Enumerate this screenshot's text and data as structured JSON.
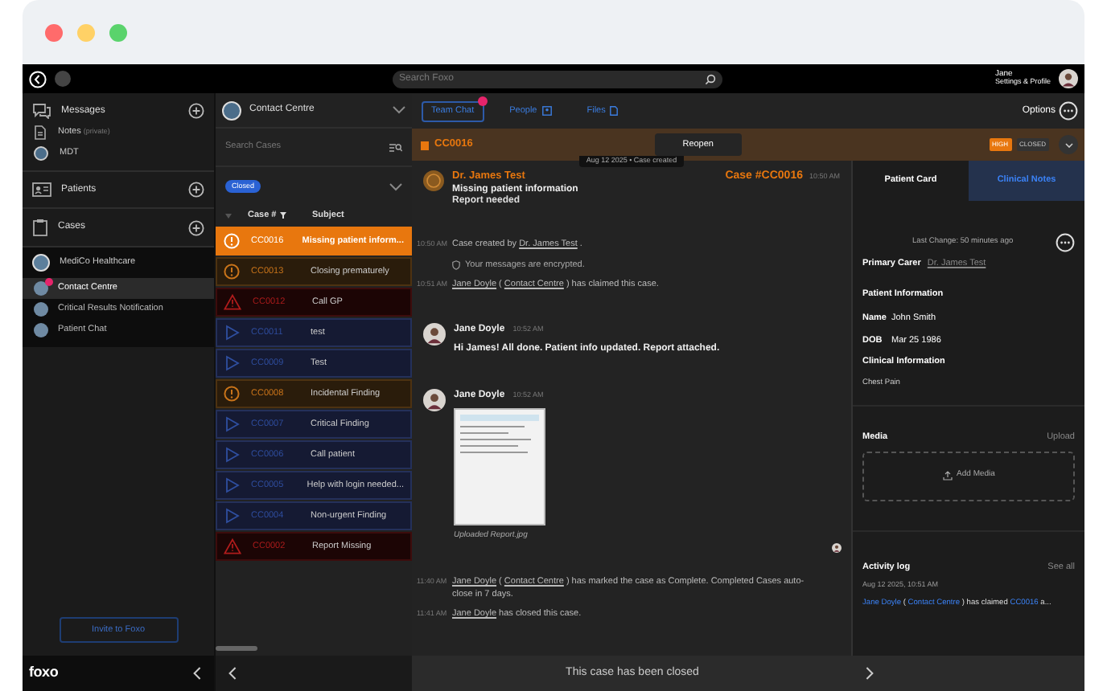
{
  "top_bar": {
    "search_placeholder": "Search Foxo",
    "user_name": "Jane",
    "user_subtitle": "Settings & Profile"
  },
  "sidebar": {
    "sections": [
      {
        "label": "Messages",
        "kind": "messages",
        "items": [
          {
            "label": "Notes",
            "note": "(private)",
            "kind": "note"
          },
          {
            "label": "MDT",
            "kind": "group"
          }
        ]
      },
      {
        "label": "Patients",
        "kind": "patients"
      },
      {
        "label": "Cases",
        "kind": "cases"
      }
    ],
    "organisation": {
      "name": "MediCo Healthcare",
      "channels": [
        {
          "label": "Contact Centre",
          "selected": true,
          "unread": true
        },
        {
          "label": "Critical Results Notification",
          "selected": false,
          "unread": false
        },
        {
          "label": "Patient Chat",
          "selected": false,
          "unread": false
        }
      ]
    },
    "invite_button": "Invite to Foxo",
    "logo": "foxo"
  },
  "cases_panel": {
    "title": "Contact Centre",
    "search_placeholder": "Search Cases",
    "filter_chip": "Closed",
    "columns": [
      "Case #",
      "Subject"
    ],
    "rows": [
      {
        "id": "CC0016",
        "subject": "Missing patient inform...",
        "kind": "warning",
        "selected": true
      },
      {
        "id": "CC0013",
        "subject": "Closing prematurely",
        "kind": "warning",
        "selected": false
      },
      {
        "id": "CC0012",
        "subject": "Call GP",
        "kind": "critical",
        "selected": false
      },
      {
        "id": "CC0011",
        "subject": "test",
        "kind": "info",
        "selected": false
      },
      {
        "id": "CC0009",
        "subject": "Test",
        "kind": "info",
        "selected": false
      },
      {
        "id": "CC0008",
        "subject": "Incidental Finding",
        "kind": "warning",
        "selected": false
      },
      {
        "id": "CC0007",
        "subject": "Critical Finding",
        "kind": "info",
        "selected": false
      },
      {
        "id": "CC0006",
        "subject": "Call patient",
        "kind": "info",
        "selected": false
      },
      {
        "id": "CC0005",
        "subject": "Help with login needed...",
        "kind": "info",
        "selected": false
      },
      {
        "id": "CC0004",
        "subject": "Non-urgent Finding",
        "kind": "info",
        "selected": false
      },
      {
        "id": "CC0002",
        "subject": "Report Missing",
        "kind": "critical",
        "selected": false
      }
    ]
  },
  "main": {
    "tabs": [
      {
        "label": "Team Chat",
        "selected": true,
        "alert": true
      },
      {
        "label": "People",
        "selected": false,
        "alert": false
      },
      {
        "label": "Files",
        "selected": false,
        "alert": false
      }
    ],
    "options": "Options",
    "case_bar": {
      "id": "CC0016",
      "action": "Reopen",
      "priority": "HIGH",
      "status": "CLOSED"
    },
    "timeline": [
      {
        "kind": "date",
        "text": "Aug 12 2025 • Case created"
      },
      {
        "kind": "case_card",
        "author": "Dr. James Test",
        "title": "Missing patient information",
        "body": "Report needed",
        "case_ref": "Case #CC0016",
        "time": "10:50 AM"
      },
      {
        "kind": "event",
        "time": "10:50 AM",
        "parts": [
          {
            "text": "Case created by ",
            "link": false
          },
          {
            "text": "Dr. James Test",
            "link": true
          },
          {
            "text": " .",
            "link": false
          }
        ]
      },
      {
        "kind": "notice",
        "text": "Your messages are encrypted."
      },
      {
        "kind": "event",
        "time": "10:51 AM",
        "parts": [
          {
            "text": "Jane Doyle",
            "link": true
          },
          {
            "text": " ( ",
            "link": false
          },
          {
            "text": "Contact Centre",
            "link": true
          },
          {
            "text": " ) has claimed this case.",
            "link": false
          }
        ]
      },
      {
        "kind": "message",
        "author": "Jane Doyle",
        "time": "10:52 AM",
        "text": "Hi James! All done. Patient info updated. Report attached."
      },
      {
        "kind": "attachment",
        "author": "Jane Doyle",
        "time": "10:52 AM",
        "caption": "Uploaded Report.jpg"
      },
      {
        "kind": "event",
        "time": "11:40 AM",
        "parts": [
          {
            "text": "Jane Doyle",
            "link": true
          },
          {
            "text": " ( ",
            "link": false
          },
          {
            "text": "Contact Centre",
            "link": true
          },
          {
            "text": " ) has marked the case as Complete. Completed Cases auto-close in 7 days.",
            "link": false
          }
        ]
      },
      {
        "kind": "event",
        "time": "11:41 AM",
        "parts": [
          {
            "text": "Jane Doyle",
            "link": true
          },
          {
            "text": " has closed this case.",
            "link": false
          }
        ]
      }
    ],
    "footer": "This case has been closed"
  },
  "patient_panel": {
    "tabs": [
      {
        "label": "Patient Card",
        "selected": true
      },
      {
        "label": "Clinical Notes",
        "selected": false
      }
    ],
    "last_change": "Last Change: 50 minutes ago",
    "primary_carer_label": "Primary Carer",
    "primary_carer": "Dr. James Test",
    "patient_heading": "Patient Information",
    "fields": [
      {
        "label": "Name",
        "value": "John Smith"
      },
      {
        "label": "DOB",
        "value": "Mar 25 1986"
      }
    ],
    "clinical_heading": "Clinical Information",
    "clinical_text": "Chest Pain",
    "media": {
      "title": "Media",
      "action": "Upload",
      "add": "Add Media"
    },
    "activity": {
      "title": "Activity log",
      "action": "See all",
      "date": "Aug 12 2025, 10:51 AM",
      "parts": [
        {
          "text": "Jane Doyle",
          "link": true
        },
        {
          "text": " ( ",
          "link": false
        },
        {
          "text": "Contact Centre",
          "link": true
        },
        {
          "text": " ) has claimed ",
          "link": false
        },
        {
          "text": "CC0016",
          "link": true
        },
        {
          "text": " a...",
          "link": false
        }
      ]
    }
  }
}
